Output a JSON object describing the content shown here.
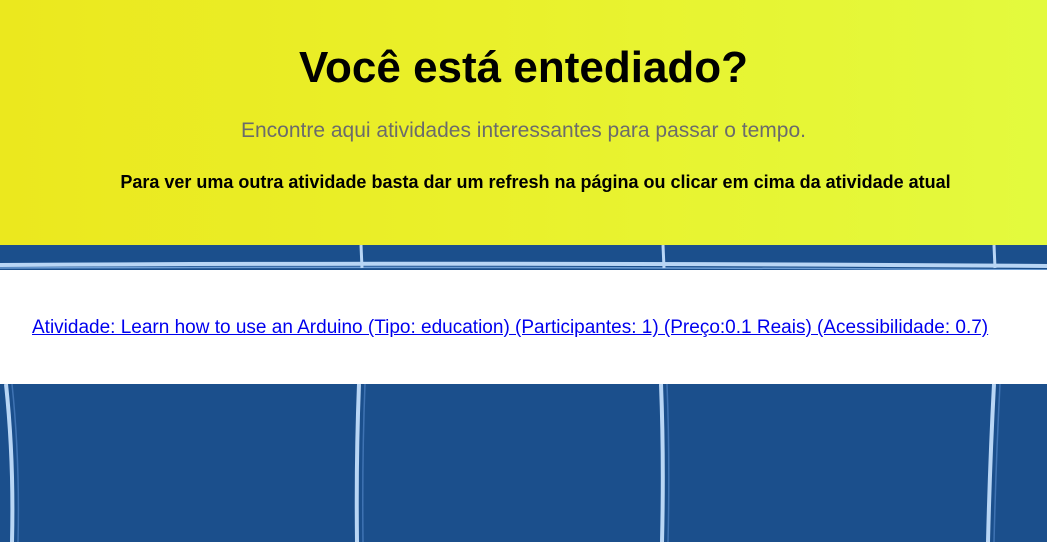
{
  "hero": {
    "title": "Você está entediado?",
    "subtitle": "Encontre aqui atividades interessantes para passar o tempo.",
    "hint": "Para ver uma outra atividade basta dar um refresh na página ou clicar em cima da atividade atual"
  },
  "activity": {
    "text": "Atividade: Learn how to use an Arduino (Tipo: education) (Participantes: 1) (Preço:0.1 Reais) (Acessibilidade: 0.7)"
  },
  "colors": {
    "hero_yellow": "#ebe81e",
    "background_blue": "#1b4f8c",
    "link_blue": "#0000ee"
  }
}
